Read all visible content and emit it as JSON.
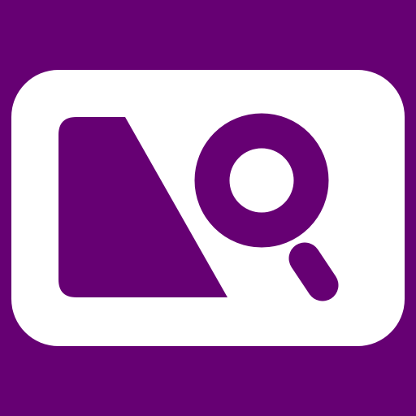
{
  "icon": {
    "name": "image-search-app-icon",
    "glyph": "image-search-icon",
    "colors": {
      "background": "#660073",
      "card": "#FFFFFF",
      "glyph": "#660073"
    }
  }
}
